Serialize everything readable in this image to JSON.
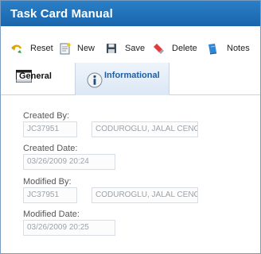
{
  "window": {
    "title": "Task Card Manual"
  },
  "toolbar": {
    "reset_label": "Reset",
    "new_label": "New",
    "save_label": "Save",
    "delete_label": "Delete",
    "notes_label": "Notes"
  },
  "tabs": {
    "general_label": "General",
    "informational_label": "Informational"
  },
  "form": {
    "created_by_label": "Created By:",
    "created_by_id": "JC37951",
    "created_by_name": "CODUROGLU, JALAL CENGIZ",
    "created_date_label": "Created Date:",
    "created_date": "03/26/2009 20:24",
    "modified_by_label": "Modified By:",
    "modified_by_id": "JC37951",
    "modified_by_name": "CODUROGLU, JALAL CENGIZ",
    "modified_date_label": "Modified Date:",
    "modified_date": "03/26/2009 20:25"
  },
  "colors": {
    "title_bar": "#1f6fb5",
    "active_tab_text": "#1a5fa6"
  },
  "icons": {
    "reset": "undo-arrow-icon",
    "new": "new-document-icon",
    "save": "floppy-disk-icon",
    "delete": "eraser-icon",
    "notes": "notes-book-icon",
    "general_tab": "window-icon",
    "informational_tab": "info-icon"
  }
}
